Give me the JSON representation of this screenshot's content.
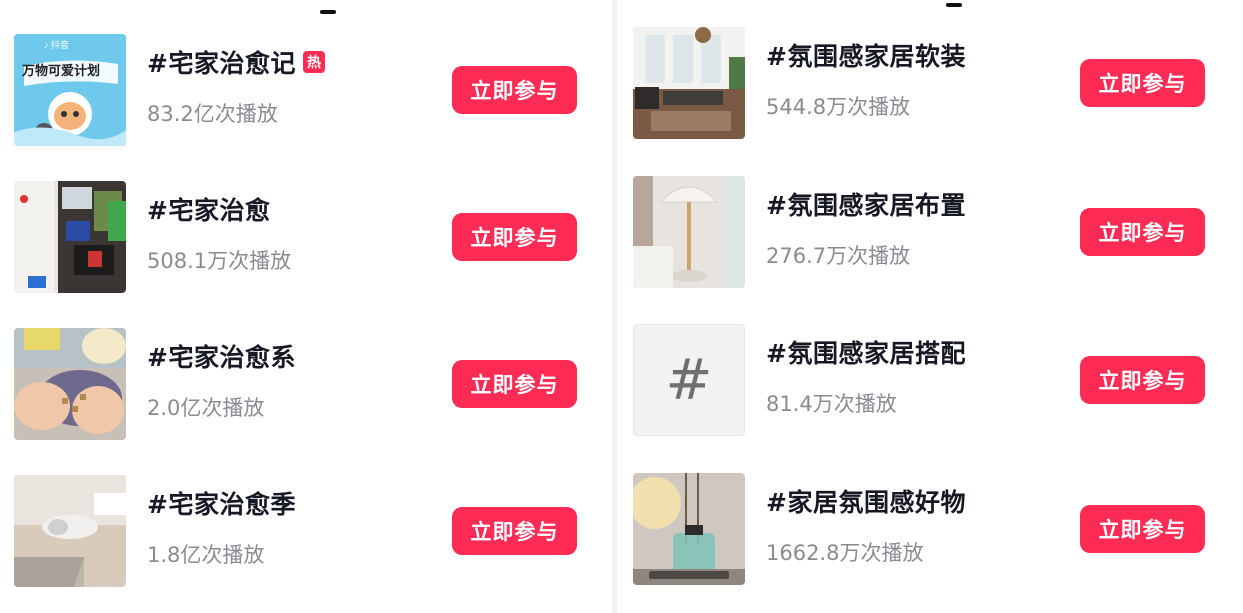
{
  "left": {
    "items": [
      {
        "title": "#宅家治愈记",
        "hot_badge": "热",
        "plays": "83.2亿次播放",
        "button": "立即参与",
        "thumb_caption_top": "万物可爱计划"
      },
      {
        "title": "#宅家治愈",
        "plays": "508.1万次播放",
        "button": "立即参与"
      },
      {
        "title": "#宅家治愈系",
        "plays": "2.0亿次播放",
        "button": "立即参与"
      },
      {
        "title": "#宅家治愈季",
        "plays": "1.8亿次播放",
        "button": "立即参与"
      }
    ]
  },
  "right": {
    "items": [
      {
        "title": "#氛围感家居软装",
        "plays": "544.8万次播放",
        "button": "立即参与"
      },
      {
        "title": "#氛围感家居布置",
        "plays": "276.7万次播放",
        "button": "立即参与"
      },
      {
        "title": "#氛围感家居搭配",
        "plays": "81.4万次播放",
        "button": "立即参与",
        "placeholder_symbol": "#"
      },
      {
        "title": "#家居氛围感好物",
        "plays": "1662.8万次播放",
        "button": "立即参与"
      }
    ]
  },
  "colors": {
    "accent": "#fe2c55",
    "title": "#161823",
    "subtle": "#8a8b91"
  },
  "icons": {
    "placeholder": "hashtag-icon",
    "hot": "hot-badge"
  }
}
